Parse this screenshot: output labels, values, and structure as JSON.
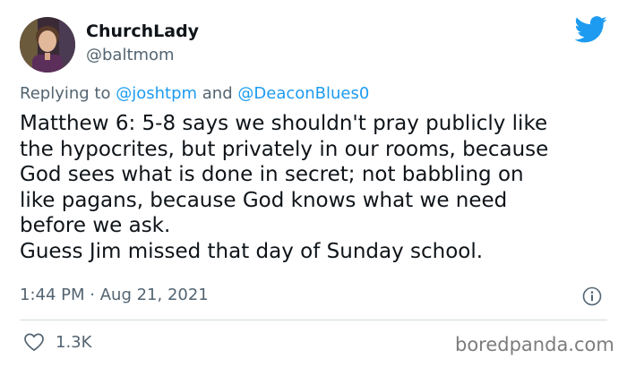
{
  "author": {
    "display_name": "ChurchLady",
    "handle": "@baltmom"
  },
  "reply": {
    "prefix": "Replying to",
    "mention_1": "@joshtpm",
    "connector": "and",
    "mention_2": "@DeaconBlues0"
  },
  "tweet": {
    "lines": [
      "Matthew 6: 5-8 says we shouldn't pray publicly like",
      "the hypocrites, but privately in our rooms, because",
      "God sees what is done in secret; not babbling on",
      "like pagans, because God knows what we need",
      "before we ask.",
      "Guess Jim missed that day of Sunday school."
    ]
  },
  "meta": {
    "time": "1:44 PM",
    "separator": "·",
    "date": "Aug 21, 2021"
  },
  "engagement": {
    "likes": "1.3K"
  },
  "watermark": "boredpanda.com",
  "colors": {
    "accent": "#1d9bf0",
    "secondary_text": "#536471",
    "divider": "#cfd9de"
  },
  "icons": {
    "brand": "twitter-bird-icon",
    "info": "info-icon",
    "like": "heart-icon"
  }
}
